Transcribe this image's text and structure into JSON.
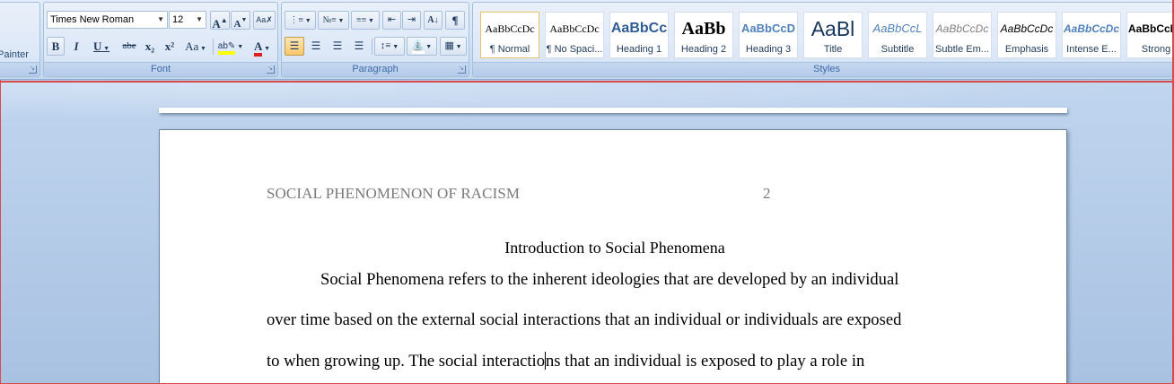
{
  "ribbon": {
    "clipboard": {
      "painter_label": "Painter"
    },
    "font": {
      "group_label": "Font",
      "font_name": "Times New Roman",
      "font_size": "12",
      "grow_glyph": "A",
      "shrink_glyph": "A",
      "bold": "B",
      "italic": "I",
      "underline": "U",
      "strike": "abe",
      "subscript": "x₂",
      "superscript": "x²",
      "change_case": "Aa",
      "font_color_glyph": "A",
      "highlight_color": "#ffff00",
      "font_color": "#e02020"
    },
    "paragraph": {
      "group_label": "Paragraph",
      "show_marks": "¶",
      "sort_glyph": "A↓"
    },
    "styles": {
      "group_label": "Styles",
      "tiles": [
        {
          "sample": "AaBbCcDc",
          "name": "¶ Normal"
        },
        {
          "sample": "AaBbCcDc",
          "name": "¶ No Spaci..."
        },
        {
          "sample": "AaBbCc",
          "name": "Heading 1"
        },
        {
          "sample": "AaBb",
          "name": "Heading 2"
        },
        {
          "sample": "AaBbCcD",
          "name": "Heading 3"
        },
        {
          "sample": "AaBl",
          "name": "Title"
        },
        {
          "sample": "AaBbCcL",
          "name": "Subtitle"
        },
        {
          "sample": "AaBbCcDc",
          "name": "Subtle Em..."
        },
        {
          "sample": "AaBbCcDc",
          "name": "Emphasis"
        },
        {
          "sample": "AaBbCcDc",
          "name": "Intense E..."
        },
        {
          "sample": "AaBbCcDc",
          "name": "Strong"
        }
      ]
    }
  },
  "document": {
    "running_head": "SOCIAL PHENOMENON OF RACISM",
    "page_number": "2",
    "heading": "Introduction to Social Phenomena",
    "line1": "Social Phenomena refers to the inherent ideologies that are developed by an individual",
    "line2": "over time based on the external social interactions that an individual or individuals are exposed",
    "line3_before_caret": "to when growing up. The social interactio",
    "line3_after_caret": "ns that an individual is exposed to play a role in"
  }
}
